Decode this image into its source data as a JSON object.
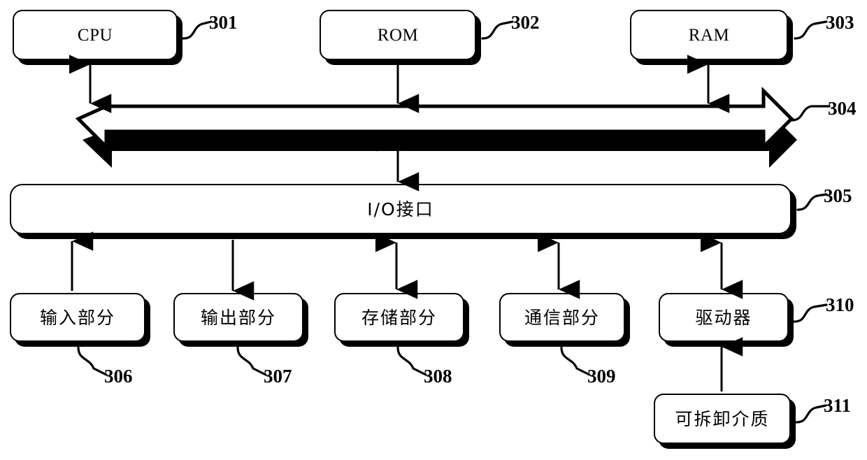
{
  "diagram": {
    "title": "Computer system architecture block diagram",
    "ink_color": "#000000",
    "background_color": "#ffffff"
  },
  "blocks": {
    "cpu": {
      "label": "CPU",
      "ref": "301"
    },
    "rom": {
      "label": "ROM",
      "ref": "302"
    },
    "ram": {
      "label": "RAM",
      "ref": "303"
    },
    "bus": {
      "label": "",
      "ref": "304"
    },
    "io": {
      "label": "I/O接口",
      "ref": "305"
    },
    "input": {
      "label": "输入部分",
      "ref": "306"
    },
    "output": {
      "label": "输出部分",
      "ref": "307"
    },
    "storage": {
      "label": "存储部分",
      "ref": "308"
    },
    "comm": {
      "label": "通信部分",
      "ref": "309"
    },
    "driver": {
      "label": "驱动器",
      "ref": "310"
    },
    "media": {
      "label": "可拆卸介质",
      "ref": "311"
    }
  },
  "connections": [
    {
      "name": "cpu-bus",
      "from": "cpu",
      "to": "bus",
      "arrow": "both"
    },
    {
      "name": "rom-bus",
      "from": "rom",
      "to": "bus",
      "arrow": "down"
    },
    {
      "name": "ram-bus",
      "from": "ram",
      "to": "bus",
      "arrow": "both"
    },
    {
      "name": "bus-io",
      "from": "bus",
      "to": "io",
      "arrow": "both"
    },
    {
      "name": "io-input",
      "from": "input",
      "to": "io",
      "arrow": "up"
    },
    {
      "name": "io-output",
      "from": "io",
      "to": "output",
      "arrow": "down"
    },
    {
      "name": "io-storage",
      "from": "io",
      "to": "storage",
      "arrow": "both"
    },
    {
      "name": "io-comm",
      "from": "io",
      "to": "comm",
      "arrow": "both"
    },
    {
      "name": "io-driver",
      "from": "io",
      "to": "driver",
      "arrow": "both"
    },
    {
      "name": "media-driver",
      "from": "media",
      "to": "driver",
      "arrow": "up"
    }
  ]
}
